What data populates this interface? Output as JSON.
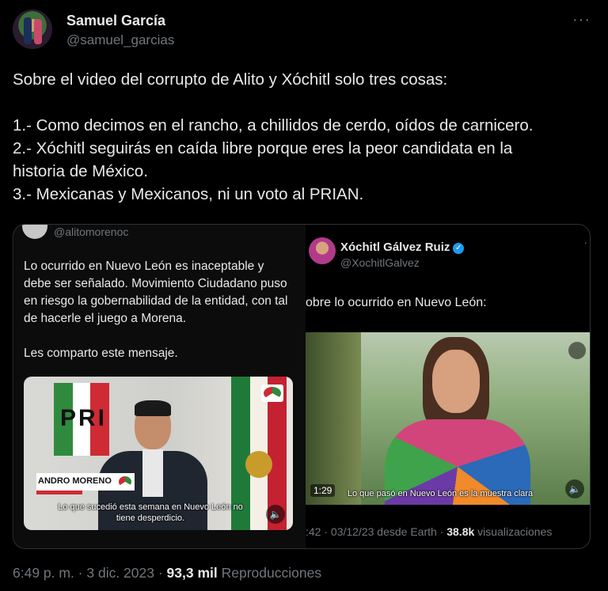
{
  "author": {
    "name": "Samuel García",
    "handle": "@samuel_garcias"
  },
  "tweet": {
    "lines": [
      "Sobre el video del corrupto de Alito y Xóchitl solo tres cosas:",
      "1.- Como decimos en el rancho, a chillidos de cerdo, oídos de carnicero.",
      "2.- Xóchitl seguirás en caída libre porque eres la peor candidata en la",
      "historia de México.",
      "3.- Mexicanas y Mexicanos, ni un voto al PRIAN."
    ]
  },
  "quote": {
    "left": {
      "handle": "@alitomorenoc",
      "text_lines": [
        "Lo ocurrido en Nuevo León es inaceptable y",
        "debe ser señalado. Movimiento Ciudadano puso",
        "en riesgo la gobernabilidad de la entidad, con tal",
        "de hacerle el juego a Morena."
      ],
      "text2": "Les comparto este mensaje.",
      "video": {
        "logo_text": "PRI",
        "name_tag": "ANDRO MORENO",
        "caption_line1": "Lo que sucedió esta semana en Nuevo León no",
        "caption_line2": "tiene desperdicio."
      }
    },
    "right": {
      "name": "Xóchitl Gálvez Ruiz",
      "handle": "@XochitlGalvez",
      "text": "obre lo ocurrido en Nuevo León:",
      "video": {
        "time": "1:29",
        "caption": "Lo que pasó en Nuevo León es la muestra clara"
      },
      "meta_prefix": ":42 · 03/12/23 desde Earth · ",
      "views_count": "38.8k",
      "views_label": " visualizaciones"
    }
  },
  "footer": {
    "timestamp": "6:49 p. m. · 3 dic. 2023 · ",
    "views_count": "93,3 mil",
    "views_label": " Reproducciones"
  },
  "icons": {
    "more": "more-icon",
    "verified": "verified-icon",
    "volume": "volume-icon"
  }
}
